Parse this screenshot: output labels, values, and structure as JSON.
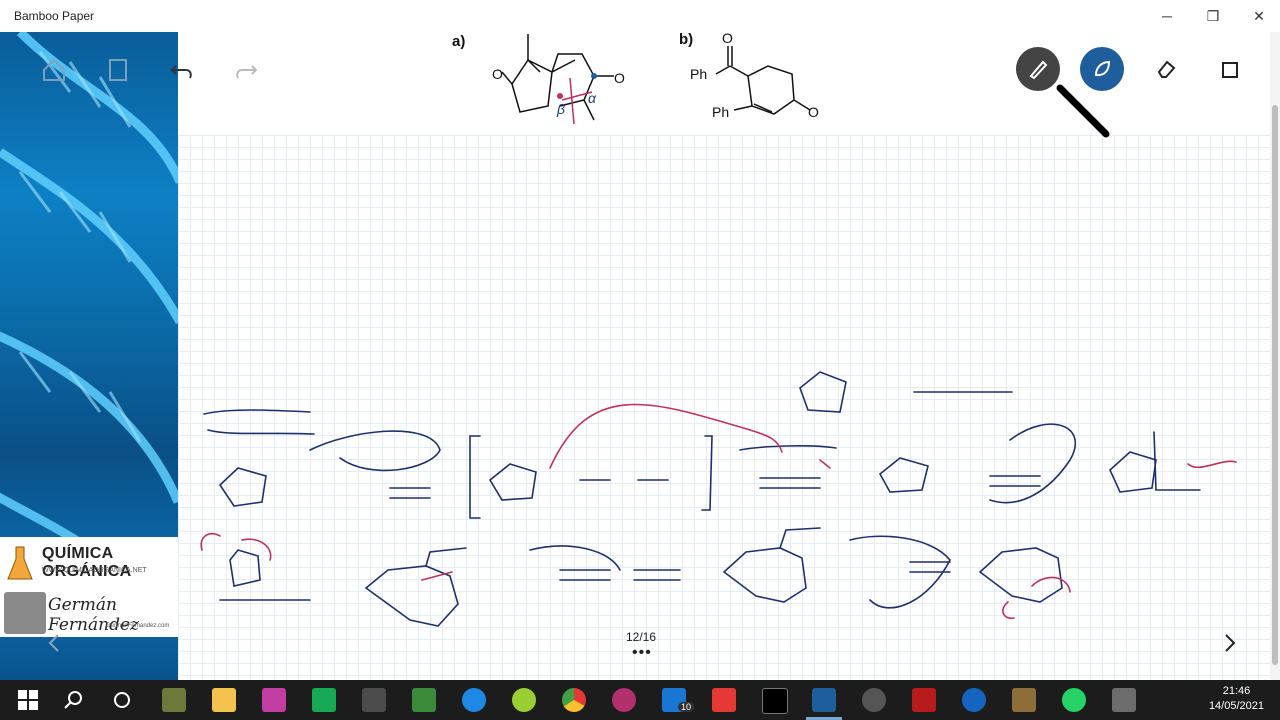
{
  "window": {
    "title": "Bamboo Paper",
    "minimize": "─",
    "maximize": "❐",
    "close": "✕"
  },
  "toolbar": {
    "icons": [
      "home-icon",
      "add-page-icon",
      "undo-icon",
      "redo-icon"
    ],
    "tools": [
      "pen-tool-icon",
      "marker-tool-icon",
      "eraser-tool-icon",
      "select-tool-icon"
    ]
  },
  "problem": {
    "a_label": "a)",
    "b_label": "b)",
    "ph_top": "Ph",
    "ph_bottom": "Ph",
    "o_a_left": "O",
    "o_a_right": "O",
    "o_b_top": "O",
    "o_b_right": "O",
    "beta": "β",
    "alpha": "α"
  },
  "sidebar": {
    "brand_title": "QUÍMICA ORGÁNICA",
    "brand_url": "WWW.QUIMICAORGANICA.NET",
    "author": "Germán Fernández",
    "author_email": "GermanFernandez.com"
  },
  "pagination": {
    "indicator": "12/16",
    "more": "•••"
  },
  "taskbar": {
    "icons": [
      "start-icon",
      "search-icon",
      "cortana-icon",
      "task-app-icon",
      "file-explorer-icon",
      "app-purple-icon",
      "app-green-icon",
      "app-teal-icon",
      "app-blue-icon",
      "android-icon",
      "chrome-icon",
      "app-pink-icon",
      "mail-icon",
      "acrobat-icon",
      "app-black-icon",
      "bamboo-paper-icon",
      "media-icon",
      "filezilla-icon",
      "app-globe-icon",
      "app-tex-icon",
      "whatsapp-icon",
      "app-gray-icon"
    ],
    "mail_badge": "10",
    "time": "21:46",
    "date": "14/05/2021"
  }
}
